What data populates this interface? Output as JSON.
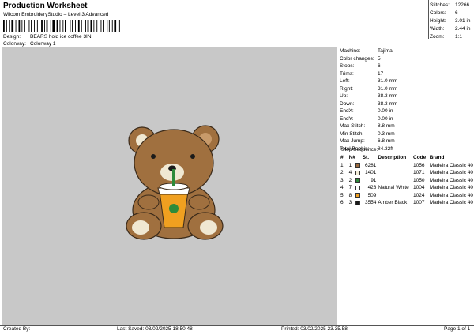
{
  "header": {
    "title": "Production Worksheet",
    "subtitle": "Wilcom EmbroideryStudio – Level 3 Advanced",
    "design_label": "Design:",
    "design_value": "BEARS hold ice coffee 3IN",
    "colorway_label": "Colorway:",
    "colorway_value": "Colorway 1"
  },
  "stats": [
    {
      "label": "Stitches:",
      "value": "12266"
    },
    {
      "label": "Colors:",
      "value": "6"
    },
    {
      "label": "Height:",
      "value": "3.01 in"
    },
    {
      "label": "Width:",
      "value": "2.44 in"
    },
    {
      "label": "Zoom:",
      "value": "1:1"
    }
  ],
  "info": [
    {
      "label": "Machine:",
      "value": "Tajima"
    },
    {
      "label": "Color changes:",
      "value": "5"
    },
    {
      "label": "Stops:",
      "value": "6"
    },
    {
      "label": "Trims:",
      "value": "17"
    },
    {
      "label": "Left:",
      "value": "31.0 mm"
    },
    {
      "label": "Right:",
      "value": "31.0 mm"
    },
    {
      "label": "Up:",
      "value": "38.3 mm"
    },
    {
      "label": "Down:",
      "value": "38.3 mm"
    },
    {
      "label": "EndX:",
      "value": "0.00 in"
    },
    {
      "label": "EndY:",
      "value": "0.00 in"
    },
    {
      "label": "Max Stitch:",
      "value": "8.8 mm"
    },
    {
      "label": "Min Stitch:",
      "value": "0.3 mm"
    },
    {
      "label": "Max Jump:",
      "value": "6.8 mm"
    },
    {
      "label": "Total Bobbin:",
      "value": "84.32ft"
    }
  ],
  "stop_sequence": {
    "title": "Stop Sequence:",
    "headers": {
      "num": "#",
      "n": "N#",
      "st": "St.",
      "desc": "Description",
      "code": "Code",
      "brand": "Brand"
    },
    "rows": [
      {
        "num": "1.",
        "n": "1",
        "color": "#9a6a3f",
        "st": "6281",
        "desc": "",
        "code": "1056",
        "brand": "Madeira Classic 40"
      },
      {
        "num": "2.",
        "n": "4",
        "color": "#f2ecd8",
        "st": "1401",
        "desc": "",
        "code": "1071",
        "brand": "Madeira Classic 40"
      },
      {
        "num": "3.",
        "n": "2",
        "color": "#2e8b3a",
        "st": "91",
        "desc": "",
        "code": "1050",
        "brand": "Madeira Classic 40"
      },
      {
        "num": "4.",
        "n": "7",
        "color": "#ffffff",
        "st": "428",
        "desc": "Natural White",
        "code": "1004",
        "brand": "Madeira Classic 40"
      },
      {
        "num": "5.",
        "n": "8",
        "color": "#f0a020",
        "st": "509",
        "desc": "",
        "code": "1024",
        "brand": "Madeira Classic 40"
      },
      {
        "num": "6.",
        "n": "3",
        "color": "#1a1a1a",
        "st": "3554",
        "desc": "Amber Black",
        "code": "1007",
        "brand": "Madeira Classic 40"
      }
    ]
  },
  "footer": {
    "created_by": "Created By:",
    "last_saved": "Last Saved: 03/02/2025 18.50.48",
    "printed": "Printed: 03/02/2025 23.35.58",
    "page": "Page 1 of 1"
  },
  "colors": {
    "canvas": "#c8c8c8",
    "bear_fur": "#a0703f",
    "bear_light": "#f0e8d2",
    "cup_fill": "#f0a020"
  }
}
